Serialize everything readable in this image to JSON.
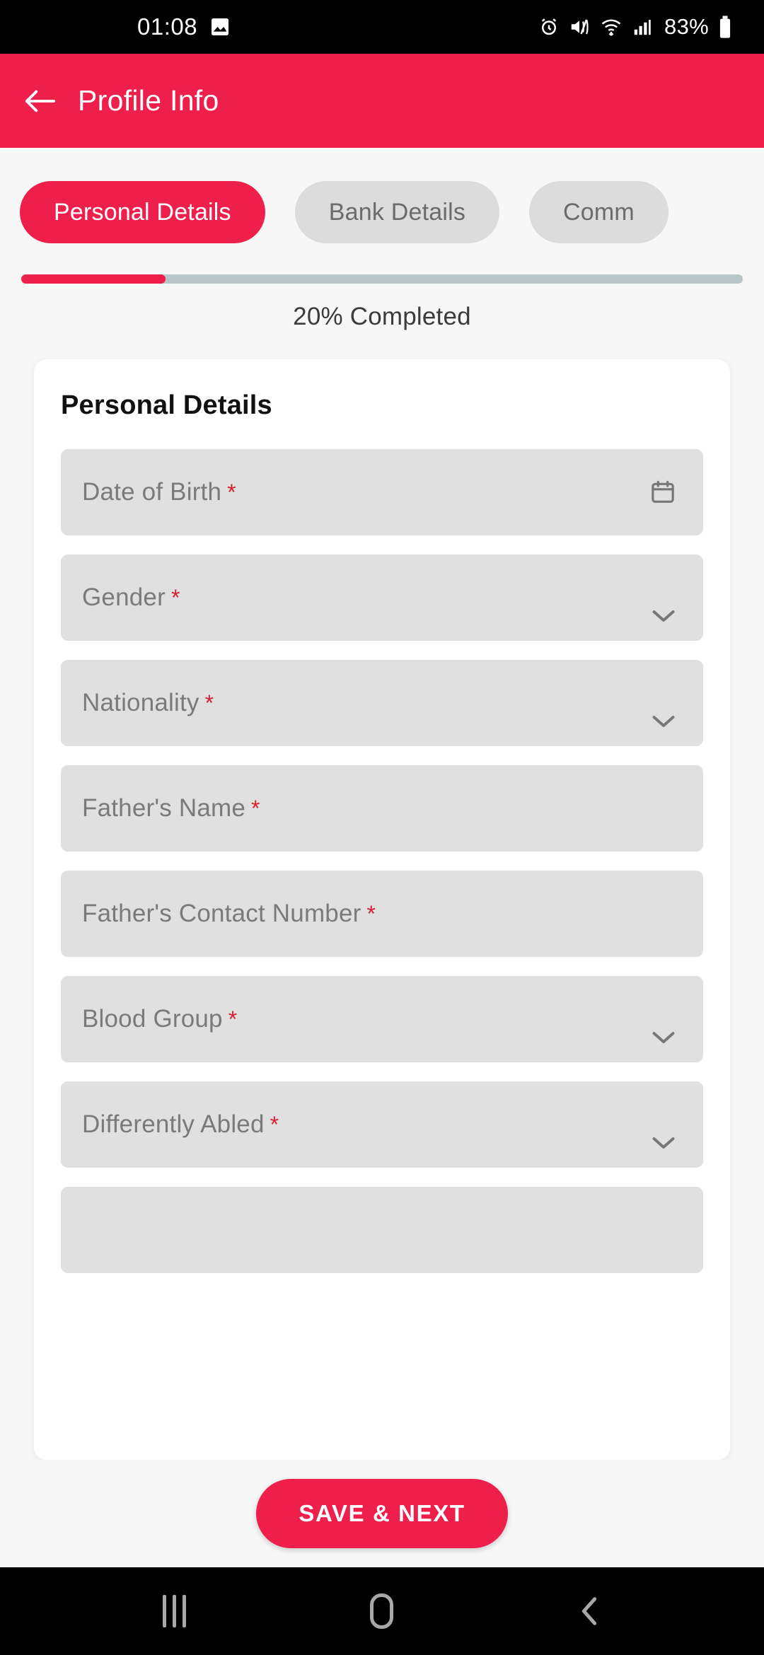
{
  "status_bar": {
    "time": "01:08",
    "battery_text": "83%",
    "icons": [
      "image-icon",
      "alarm-icon",
      "vibrate-mute-icon",
      "wifi-icon",
      "signal-icon",
      "battery-icon"
    ]
  },
  "app_bar": {
    "title": "Profile Info",
    "back_icon": "arrow-left-icon",
    "background_color": "#EE1F4A"
  },
  "tabs": [
    {
      "label": "Personal Details",
      "active": true
    },
    {
      "label": "Bank Details",
      "active": false
    },
    {
      "label": "Comm",
      "active": false
    }
  ],
  "progress": {
    "percent": 20,
    "label": "20% Completed",
    "fill_color": "#EE1F4A",
    "track_color": "#B8C6C8"
  },
  "card": {
    "title": "Personal Details",
    "fields": [
      {
        "label": "Date of Birth",
        "required": "*",
        "trailing_icon": "calendar-icon",
        "type": "date"
      },
      {
        "label": "Gender",
        "required": "*",
        "trailing_icon": "chevron-down-icon",
        "type": "select"
      },
      {
        "label": "Nationality",
        "required": "*",
        "trailing_icon": "chevron-down-icon",
        "type": "select"
      },
      {
        "label": "Father's Name",
        "required": "*",
        "trailing_icon": "",
        "type": "text"
      },
      {
        "label": "Father's Contact Number",
        "required": "*",
        "trailing_icon": "",
        "type": "text"
      },
      {
        "label": "Blood Group",
        "required": "*",
        "trailing_icon": "chevron-down-icon",
        "type": "select"
      },
      {
        "label": "Differently Abled",
        "required": "*",
        "trailing_icon": "chevron-down-icon",
        "type": "select"
      }
    ]
  },
  "bottom": {
    "save_label": "SAVE & NEXT"
  },
  "nav_bar": {
    "recents_icon": "recents-icon",
    "home_icon": "home-icon",
    "back_icon": "back-chevron-icon"
  }
}
